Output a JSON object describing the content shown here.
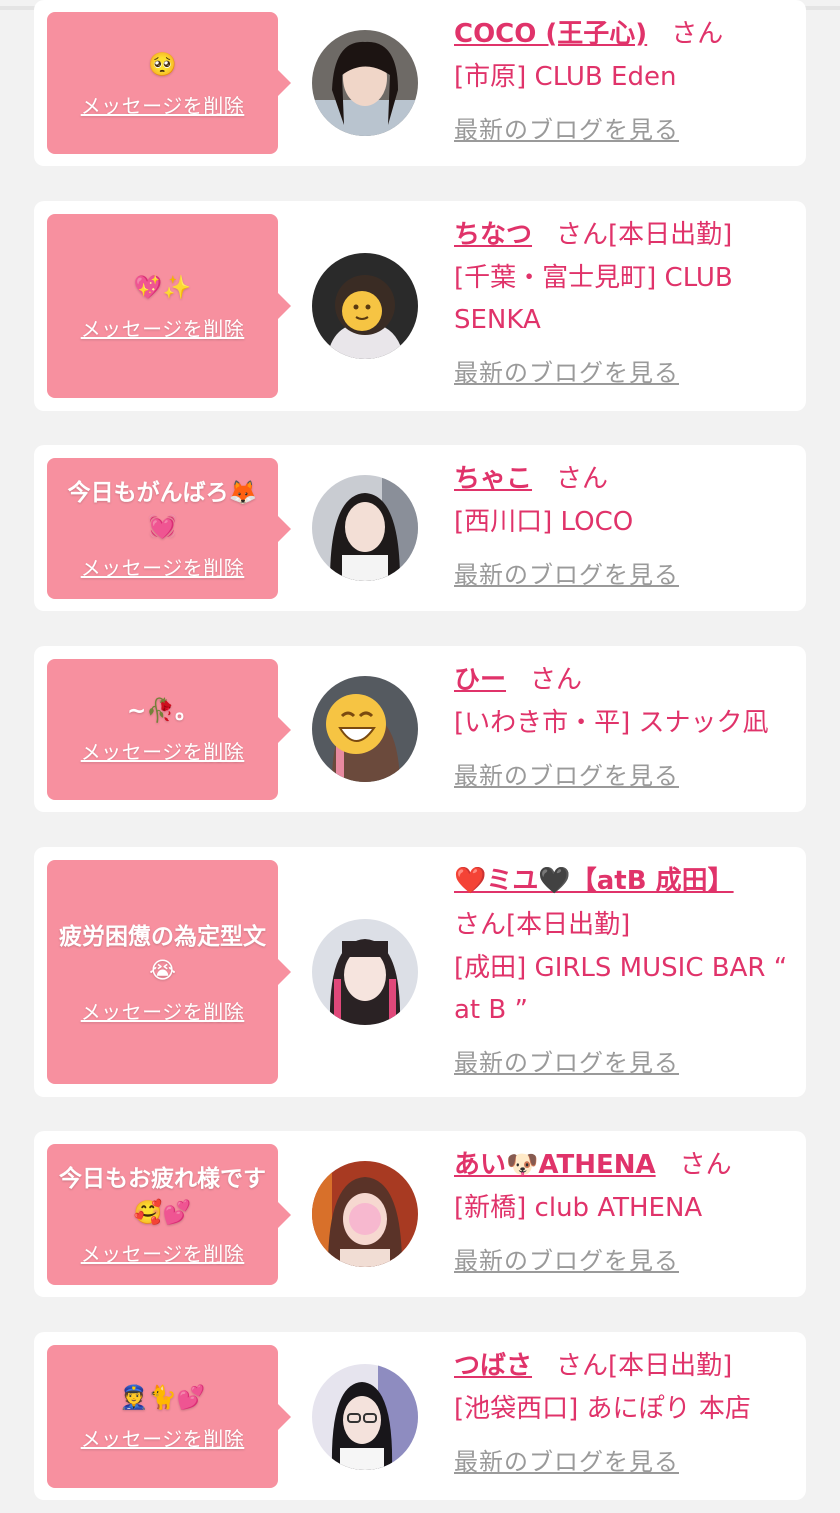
{
  "cards": [
    {
      "message": "🥺",
      "delete_label": "メッセージを削除",
      "name": "COCO (王子心)",
      "honorific": "さん",
      "badge": "",
      "shop": "[市原] CLUB Eden",
      "blog_label": "最新のブログを見る"
    },
    {
      "message": "💖✨",
      "delete_label": "メッセージを削除",
      "name": "ちなつ",
      "honorific": "さん",
      "badge": "[本日出勤]",
      "shop": "[千葉・富士見町] CLUB SENKA",
      "blog_label": "最新のブログを見る"
    },
    {
      "message": "今日もがんばろ🦊💓",
      "delete_label": "メッセージを削除",
      "name": "ちゃこ",
      "honorific": "さん",
      "badge": "",
      "shop": "[西川口] LOCO",
      "blog_label": "最新のブログを見る"
    },
    {
      "message": "~🥀。",
      "delete_label": "メッセージを削除",
      "name": "ひー",
      "honorific": "さん",
      "badge": "",
      "shop": "[いわき市・平] スナック凪",
      "blog_label": "最新のブログを見る"
    },
    {
      "message": "疲労困憊の為定型文😭",
      "delete_label": "メッセージを削除",
      "name": "❤️ミユ🖤【atB 成田】",
      "honorific": "さん",
      "badge": "[本日出勤]",
      "shop": "[成田] GIRLS MUSIC BAR “ at B ”",
      "blog_label": "最新のブログを見る"
    },
    {
      "message": "今日もお疲れ様です🥰💕",
      "delete_label": "メッセージを削除",
      "name": "あい🐶ATHENA",
      "honorific": "さん",
      "badge": "",
      "shop": "[新橋] club ATHENA",
      "blog_label": "最新のブログを見る"
    },
    {
      "message": "👮🐈💕",
      "delete_label": "メッセージを削除",
      "name": "つばさ",
      "honorific": "さん",
      "badge": "[本日出勤]",
      "shop": "[池袋西口] あにぽり 本店",
      "blog_label": "最新のブログを見る"
    }
  ],
  "colors": {
    "accent": "#e0336a",
    "bubble": "#f7909f",
    "background": "#f2f2f2",
    "link_gray": "#9a9a9a"
  }
}
